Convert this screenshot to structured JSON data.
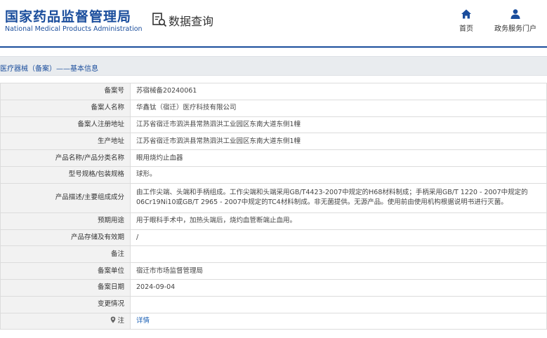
{
  "header": {
    "logo_cn": "国家药品监督管理局",
    "logo_en": "National Medical Products Administration",
    "query_title": "数据查询",
    "nav": [
      {
        "label": "首页",
        "icon": "home-icon"
      },
      {
        "label": "政务服务门户",
        "icon": "user-icon"
      }
    ]
  },
  "section": {
    "title": "医疗器械（备案）——基本信息"
  },
  "record": {
    "rows": [
      {
        "label": "备案号",
        "value": "苏宿械备20240061"
      },
      {
        "label": "备案人名称",
        "value": "华鑫钛（宿迁）医疗科技有限公司"
      },
      {
        "label": "备案人注册地址",
        "value": "江苏省宿迁市泗洪县常熟泗洪工业园区东南大道东侧1幢"
      },
      {
        "label": "生产地址",
        "value": "江苏省宿迁市泗洪县常熟泗洪工业园区东南大道东侧1幢"
      },
      {
        "label": "产品名称/产品分类名称",
        "value": "眼用烧灼止血器"
      },
      {
        "label": "型号规格/包装规格",
        "value": "球形。"
      },
      {
        "label": "产品描述/主要组成成分",
        "value": "由工作尖端、头端和手柄组成。工作尖端和头端采用GB/T4423-2007中规定的H68材料制成；手柄采用GB/T 1220 - 2007中规定的06Cr19Ni10或GB/T 2965 - 2007中规定的TC4材料制成。非无菌提供。无源产品。使用前由使用机构根据说明书进行灭菌。"
      },
      {
        "label": "预期用途",
        "value": "用于眼科手术中，加热头端后，烧灼血管断端止血用。"
      },
      {
        "label": "产品存储及有效期",
        "value": "/"
      },
      {
        "label": "备注",
        "value": ""
      },
      {
        "label": "备案单位",
        "value": "宿迁市市场监督管理局"
      },
      {
        "label": "备案日期",
        "value": "2024-09-04"
      },
      {
        "label": "变更情况",
        "value": ""
      }
    ],
    "note_row": {
      "label": "注",
      "icon": "pin-icon",
      "link": "详情"
    }
  },
  "colors": {
    "brand": "#1a4d9c",
    "label_bg": "#f2f2f2",
    "section_bg": "#e9ecef",
    "link": "#1a5fb4"
  }
}
